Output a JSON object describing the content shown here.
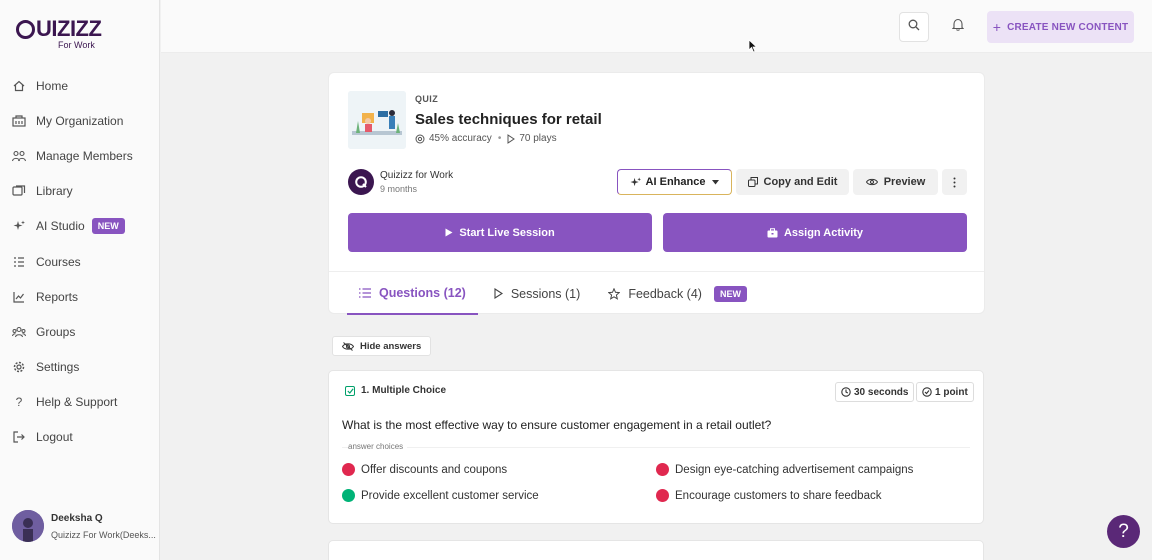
{
  "brand": {
    "name": "UIZIZZ",
    "sub": "For Work"
  },
  "sidebar": {
    "items": [
      {
        "label": "Home",
        "icon": "home-icon"
      },
      {
        "label": "My Organization",
        "icon": "building-icon"
      },
      {
        "label": "Manage Members",
        "icon": "users-icon"
      },
      {
        "label": "Library",
        "icon": "library-icon"
      },
      {
        "label": "AI Studio",
        "icon": "sparkle-icon",
        "badge": "NEW"
      },
      {
        "label": "Courses",
        "icon": "courses-icon"
      },
      {
        "label": "Reports",
        "icon": "chart-icon"
      },
      {
        "label": "Groups",
        "icon": "groups-icon"
      },
      {
        "label": "Settings",
        "icon": "gear-icon"
      },
      {
        "label": "Help & Support",
        "icon": "question-icon"
      },
      {
        "label": "Logout",
        "icon": "logout-icon"
      }
    ],
    "user": {
      "name": "Deeksha Q",
      "org": "Quizizz For Work(Deeks..."
    }
  },
  "topbar": {
    "create_label": "CREATE NEW CONTENT"
  },
  "quiz": {
    "type": "QUIZ",
    "title": "Sales techniques for retail",
    "accuracy": "45% accuracy",
    "plays": "70 plays",
    "owner": "Quizizz for Work",
    "time": "9 months"
  },
  "actions": {
    "ai_enhance": "AI Enhance",
    "copy_edit": "Copy and Edit",
    "preview": "Preview",
    "start_live": "Start Live Session",
    "assign": "Assign Activity"
  },
  "tabs": {
    "questions": "Questions (12)",
    "sessions": "Sessions (1)",
    "feedback": "Feedback (4)",
    "feedback_badge": "NEW"
  },
  "hide_answers": "Hide answers",
  "question": {
    "header": "1. Multiple Choice",
    "time": "30 seconds",
    "points": "1 point",
    "text": "What is the most effective way to ensure customer engagement in a retail outlet?",
    "answers_label": "answer choices",
    "choices": [
      {
        "text": "Offer discounts and coupons",
        "correct": false
      },
      {
        "text": "Design eye-catching advertisement campaigns",
        "correct": false
      },
      {
        "text": "Provide excellent customer service",
        "correct": true
      },
      {
        "text": "Encourage customers to share feedback",
        "correct": false
      }
    ]
  },
  "help": "?",
  "colors": {
    "accent": "#8854c0",
    "brand": "#3b1650",
    "correct": "#00b377",
    "wrong": "#e0284f"
  }
}
